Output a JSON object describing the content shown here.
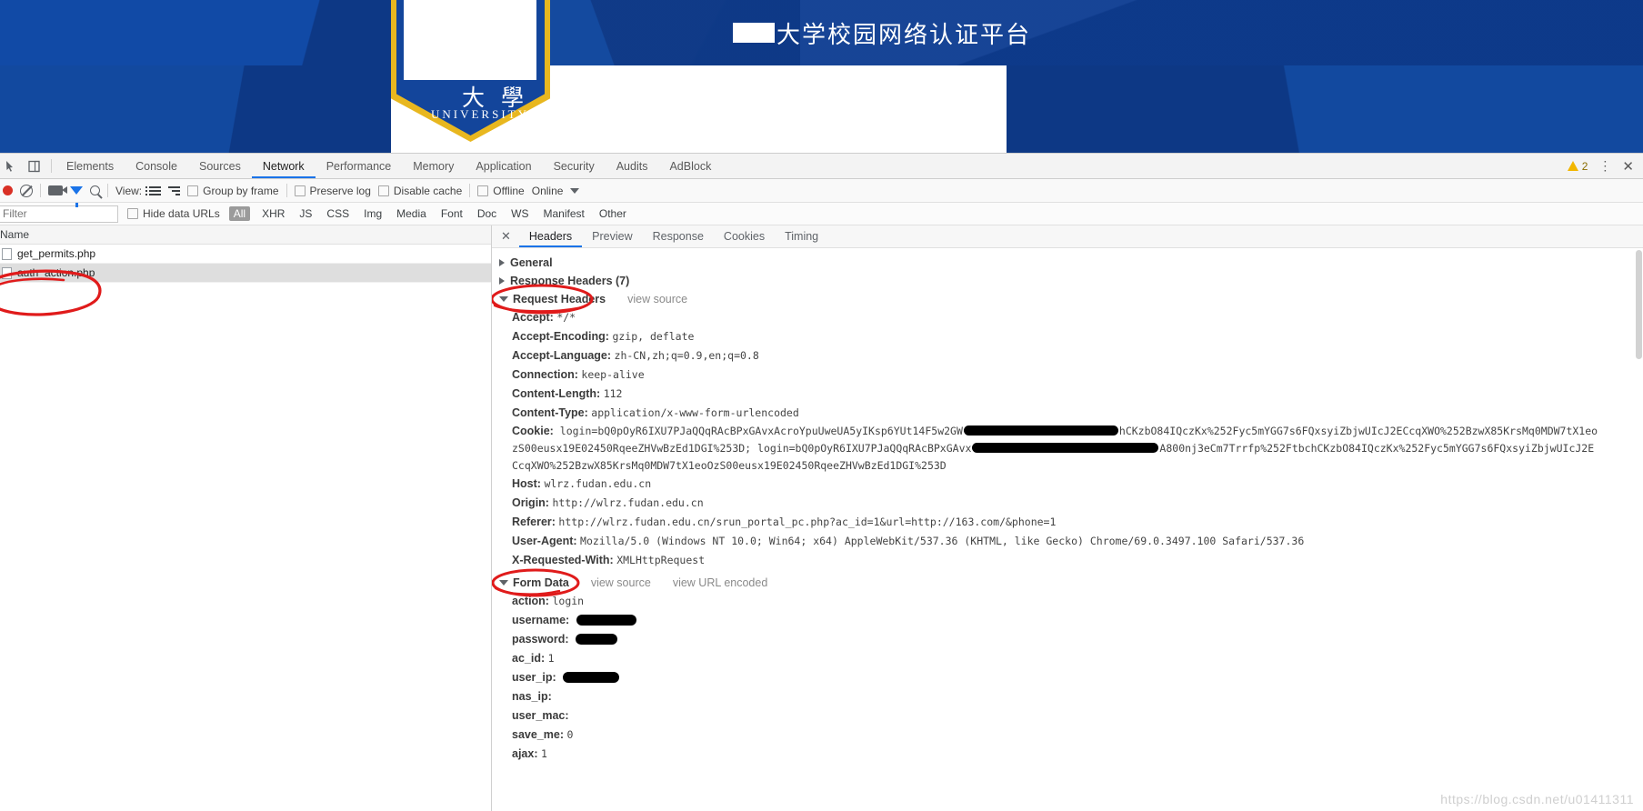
{
  "site_banner": {
    "title_text": "大学校园网络认证平台",
    "crest_char": "大 學",
    "crest_subtitle": "UNIVERSITY",
    "brand_blue": "#0e3d92",
    "brand_gold": "#e8b71f"
  },
  "devtools": {
    "tabs": [
      {
        "label": "Elements",
        "active": false
      },
      {
        "label": "Console",
        "active": false
      },
      {
        "label": "Sources",
        "active": false
      },
      {
        "label": "Network",
        "active": true
      },
      {
        "label": "Performance",
        "active": false
      },
      {
        "label": "Memory",
        "active": false
      },
      {
        "label": "Application",
        "active": false
      },
      {
        "label": "Security",
        "active": false
      },
      {
        "label": "Audits",
        "active": false
      },
      {
        "label": "AdBlock",
        "active": false
      }
    ],
    "icons": {
      "inspect": "inspect-element-icon",
      "device": "device-toolbar-icon"
    },
    "warning_count": "2",
    "kebab": "⋮",
    "close": "✕",
    "accent_color": "#1a73e8"
  },
  "network_toolbar": {
    "record_label": "record-button",
    "clear_label": "clear-button",
    "view_label": "View:",
    "group_by_frame": "Group by frame",
    "preserve_log": "Preserve log",
    "disable_cache": "Disable cache",
    "offline": "Offline",
    "throttling": "Online"
  },
  "filter_bar": {
    "filter_placeholder": "Filter",
    "hide_data_urls": "Hide data URLs",
    "types": [
      "All",
      "XHR",
      "JS",
      "CSS",
      "Img",
      "Media",
      "Font",
      "Doc",
      "WS",
      "Manifest",
      "Other"
    ],
    "active_type": "All"
  },
  "requests_pane": {
    "column_header": "Name",
    "rows": [
      {
        "name": "get_permits.php",
        "selected": false
      },
      {
        "name": "auth_action.php",
        "selected": true
      }
    ]
  },
  "details_pane": {
    "tabs": [
      {
        "label": "Headers",
        "active": true
      },
      {
        "label": "Preview",
        "active": false
      },
      {
        "label": "Response",
        "active": false
      },
      {
        "label": "Cookies",
        "active": false
      },
      {
        "label": "Timing",
        "active": false
      }
    ],
    "sections": [
      {
        "title": "General",
        "expanded": false
      },
      {
        "title": "Response Headers (7)",
        "expanded": false
      },
      {
        "title": "Request Headers",
        "expanded": true,
        "view_source": "view source"
      }
    ],
    "request_headers": [
      {
        "key": "Accept:",
        "value": "*/*"
      },
      {
        "key": "Accept-Encoding:",
        "value": "gzip, deflate"
      },
      {
        "key": "Accept-Language:",
        "value": "zh-CN,zh;q=0.9,en;q=0.8"
      },
      {
        "key": "Connection:",
        "value": "keep-alive"
      },
      {
        "key": "Content-Length:",
        "value": "112"
      },
      {
        "key": "Content-Type:",
        "value": "application/x-www-form-urlencoded"
      }
    ],
    "cookie_header": {
      "key": "Cookie:",
      "line1_visible": "login=bQ0pOyR6IXU7PJaQQqRAcBPxGAvxAcroYpuUweUA5yIKsp6YUt14F5w2GW",
      "line1_tail": "hCKzbO84IQczKx%252Fyc5mYGG7s6FQxsyiZbjwUIcJ2ECcqXWO%252BzwX85KrsMq0MDW7tX1eo",
      "line2_head": "zS00eusx19E02450RqeeZHVwBzEd1DGI%253D; login=bQ0pOyR6IXU7PJaQQqRAcBPxGAvx",
      "line2_tail": "A800nj3eCm7Trrfp%252FtbchCKzbO84IQczKx%252Fyc5mYGG7s6FQxsyiZbjwUIcJ2E",
      "line3": "CcqXWO%252BzwX85KrsMq0MDW7tX1eoOzS00eusx19E02450RqeeZHVwBzEd1DGI%253D"
    },
    "request_headers_rest": [
      {
        "key": "Host:",
        "value": "wlrz.fudan.edu.cn"
      },
      {
        "key": "Origin:",
        "value": "http://wlrz.fudan.edu.cn"
      },
      {
        "key": "Referer:",
        "value": "http://wlrz.fudan.edu.cn/srun_portal_pc.php?ac_id=1&url=http://163.com/&phone=1"
      },
      {
        "key": "User-Agent:",
        "value": "Mozilla/5.0 (Windows NT 10.0; Win64; x64) AppleWebKit/537.36 (KHTML, like Gecko) Chrome/69.0.3497.100 Safari/537.36"
      },
      {
        "key": "X-Requested-With:",
        "value": "XMLHttpRequest"
      }
    ],
    "form_data_section": {
      "title": "Form Data",
      "view_source": "view source",
      "view_url_encoded": "view URL encoded",
      "expanded": true
    },
    "form_data": [
      {
        "key": "action:",
        "value": "login",
        "redacted": false
      },
      {
        "key": "username:",
        "value": "",
        "redacted": true,
        "redact_width": 66
      },
      {
        "key": "password:",
        "value": "",
        "redacted": true,
        "redact_width": 46
      },
      {
        "key": "ac_id:",
        "value": "1",
        "redacted": false
      },
      {
        "key": "user_ip:",
        "value": "",
        "redacted": true,
        "redact_width": 62
      },
      {
        "key": "nas_ip:",
        "value": "",
        "redacted": false
      },
      {
        "key": "user_mac:",
        "value": "",
        "redacted": false
      },
      {
        "key": "save_me:",
        "value": "0",
        "redacted": false
      },
      {
        "key": "ajax:",
        "value": "1",
        "redacted": false
      }
    ]
  },
  "watermark": "https://blog.csdn.net/u01411311",
  "annotations": {
    "color": "#e01b1b",
    "circles": [
      "auth_action.php row",
      "Request Headers label",
      "Form Data label"
    ]
  }
}
